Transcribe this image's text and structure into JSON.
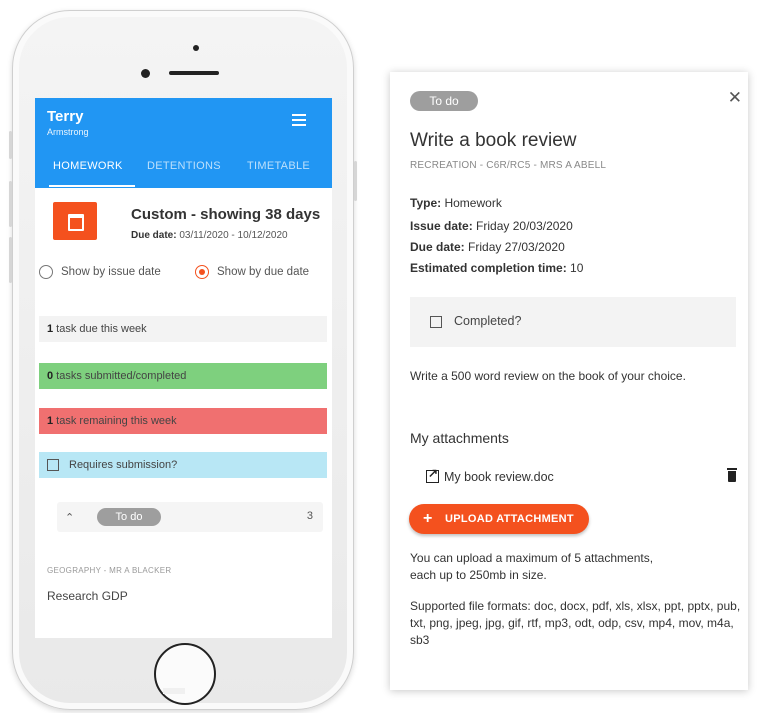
{
  "student": {
    "first_name": "Terry",
    "last_name": "Armstrong"
  },
  "tabs": [
    {
      "label": "HOMEWORK"
    },
    {
      "label": "DETENTIONS"
    },
    {
      "label": "TIMETABLE"
    }
  ],
  "filter": {
    "title": "Custom - showing 38 days",
    "due_label": "Due date:",
    "due_range": "03/11/2020 - 10/12/2020",
    "radio_issue": "Show by issue date",
    "radio_due": "Show by due date"
  },
  "summary": {
    "due_count": "1",
    "due_text": " task due this week",
    "submitted_count": "0",
    "submitted_text": " tasks submitted/completed",
    "remaining_count": "1",
    "remaining_text": " task remaining this week",
    "requires_submission": "Requires submission?"
  },
  "todo_group": {
    "label": "To do",
    "count": "3"
  },
  "task_item": {
    "subject": "GEOGRAPHY - MR A BLACKER",
    "title": "Research GDP"
  },
  "detail": {
    "status": "To do",
    "title": "Write a book review",
    "subtitle": "RECREATION - C6R/RC5 - MRS A ABELL",
    "type_label": "Type:",
    "type_value": "Homework",
    "issue_label": "Issue date:",
    "issue_value": "Friday 20/03/2020",
    "due_label": "Due date:",
    "due_value": "Friday 27/03/2020",
    "est_label": "Estimated completion time:",
    "est_value": "10",
    "completed_label": "Completed?",
    "description": "Write a 500 word review on the book of your choice.",
    "attachments_heading": "My attachments",
    "attachment_file": "My book review.doc",
    "upload_label": "UPLOAD ATTACHMENT",
    "upload_note_1": "You can upload a maximum of 5 attachments,",
    "upload_note_2": "each up to 250mb in size.",
    "formats_note": "Supported file formats: doc, docx, pdf, xls, xlsx, ppt, pptx, pub, txt, png, jpeg, jpg, gif, rtf, mp3, odt, odp, csv, mp4, mov, m4a, sb3"
  },
  "colors": {
    "appbar": "#2196f3",
    "accent": "#f4511e",
    "green": "#7ed07e",
    "red": "#f07070",
    "cyan": "#b8e7f5",
    "chip": "#9e9e9e"
  }
}
